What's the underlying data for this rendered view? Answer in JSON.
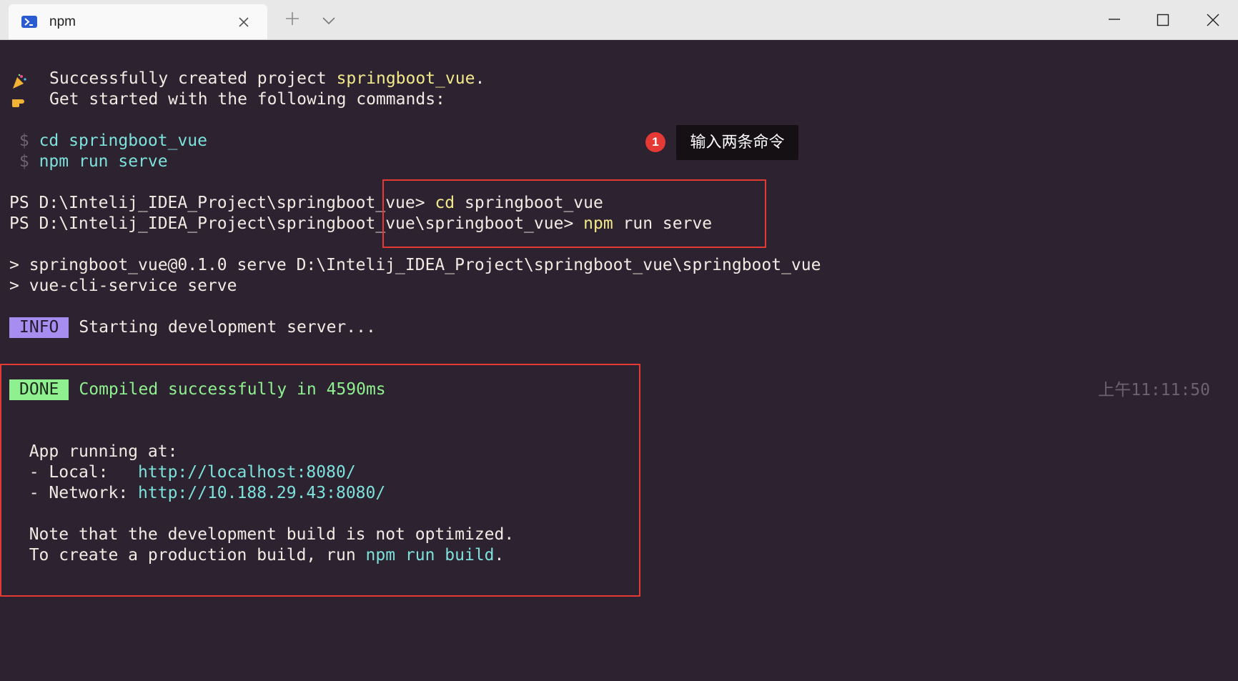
{
  "window": {
    "tab_title": "npm",
    "icons": [
      "powershell-icon",
      "close-icon",
      "plus-icon",
      "chevron-down-icon",
      "minimize-icon",
      "maximize-icon",
      "close-icon"
    ]
  },
  "terminal": {
    "created_prefix": "Successfully created project ",
    "project_name": "springboot_vue",
    "created_suffix": ".",
    "get_started": "Get started with the following commands:",
    "cmd1_prompt": "$",
    "cmd1_text": "cd springboot_vue",
    "cmd2_prompt": "$",
    "cmd2_text": "npm run serve",
    "ps1_prompt": "PS D:\\Intelij_IDEA_Project\\springboot_vue> ",
    "ps1_cmd": "cd",
    "ps1_arg": " springboot_vue",
    "ps2_prompt": "PS D:\\Intelij_IDEA_Project\\springboot_vue\\springboot_vue> ",
    "ps2_cmd": "npm",
    "ps2_arg": " run serve",
    "out1": "> springboot_vue@0.1.0 serve D:\\Intelij_IDEA_Project\\springboot_vue\\springboot_vue",
    "out2": "> vue-cli-service serve",
    "info_badge": "INFO",
    "info_text": "Starting development server...",
    "done_badge": "DONE",
    "done_text": "Compiled successfully in 4590ms",
    "timestamp": "上午11:11:50",
    "app_running": "App running at:",
    "local_label": "- Local:   ",
    "local_url": "http://localhost:8080/",
    "network_label": "- Network: ",
    "network_url": "http://10.188.29.43:8080/",
    "note1": "Note that the development build is not optimized.",
    "note2_prefix": "To create a production build, run ",
    "note2_cmd": "npm run build",
    "note2_suffix": "."
  },
  "annotation": {
    "number": "1",
    "label": "输入两条命令"
  },
  "colors": {
    "background": "#2c2230",
    "yellow": "#f3e98b",
    "cyan": "#7ee2dc",
    "green": "#8ef08e",
    "info_badge": "#a78df0",
    "highlight_box": "#e53935"
  }
}
